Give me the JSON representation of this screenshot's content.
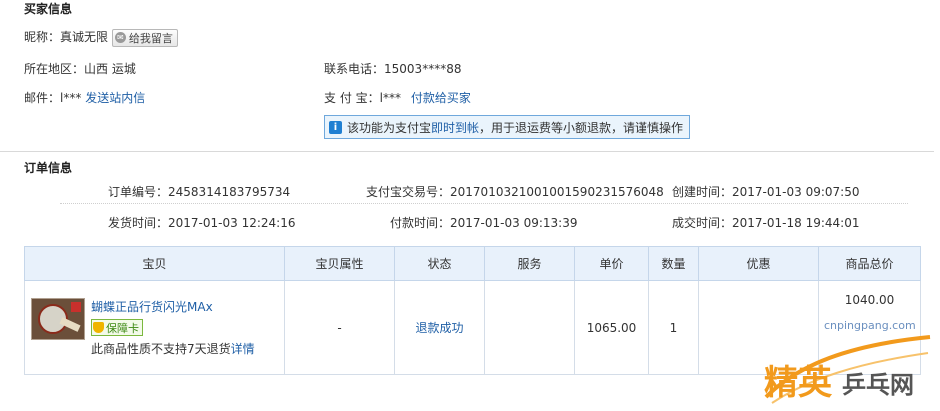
{
  "buyer": {
    "title": "买家信息",
    "nickname_label": "昵称：",
    "nickname": "真诚无限",
    "message_button": "给我留言",
    "region_label": "所在地区：",
    "region": "山西 运城",
    "phone_label": "联系电话：",
    "phone": "15003****88",
    "email_label": "邮件：",
    "email": "l***",
    "email_link": "发送站内信",
    "alipay_label": "支 付 宝：",
    "alipay": "l***",
    "alipay_link": "付款给买家",
    "notice_pre": "该功能为支付宝",
    "notice_link": "即时到帐",
    "notice_post": "，用于退运费等小额退款，请谨慎操作"
  },
  "order": {
    "title": "订单信息",
    "order_no_label": "订单编号：",
    "order_no": "2458314183795734",
    "alipay_trade_label": "支付宝交易号：",
    "alipay_trade": "20170103210010015902315760​48",
    "created_label": "创建时间：",
    "created": "2017-01-03 09:07:50",
    "shipped_label": "发货时间：",
    "shipped": "2017-01-03 12:24:16",
    "paid_label": "付款时间：",
    "paid": "2017-01-03 09:13:39",
    "completed_label": "成交时间：",
    "completed": "2017-01-18 19:44:01"
  },
  "table": {
    "headers": [
      "宝贝",
      "宝贝属性",
      "状态",
      "服务",
      "单价",
      "数量",
      "优惠",
      "商品总价"
    ],
    "item": {
      "title": "蝴蝶正品行货闪光MAx",
      "badge": "保障卡",
      "note_pre": "此商品性质不支持7天退货",
      "note_link": "详情",
      "attributes": "-",
      "status": "退款成功",
      "service": "",
      "unit_price": "1065.00",
      "quantity": "1",
      "discount": "",
      "total": "1040.00"
    }
  },
  "watermark": {
    "url": "cnpingpang.com",
    "text_a": "精英",
    "text_b": "乒乓网"
  },
  "colors": {
    "link": "#1f5fa6",
    "header_bg": "#e8f1fb",
    "notice_bg": "#eaf4fc",
    "watermark_orange": "#f29a1c"
  }
}
